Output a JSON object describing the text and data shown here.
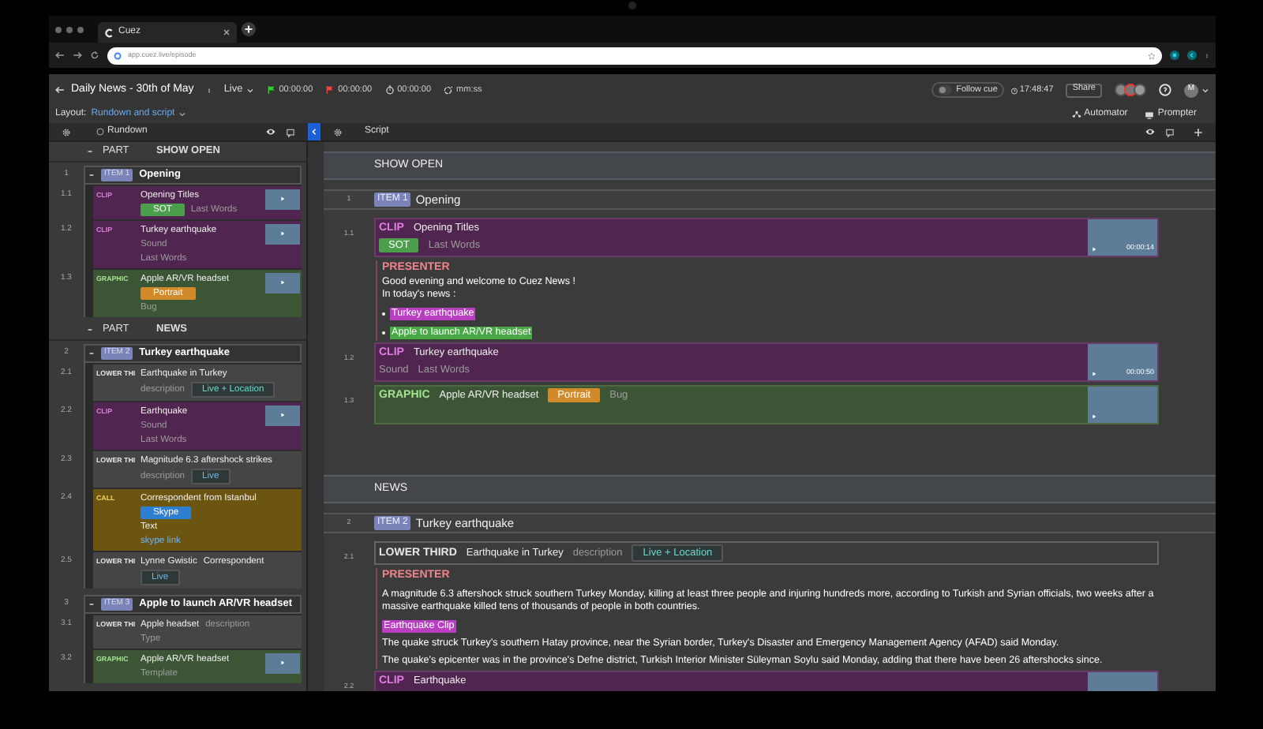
{
  "browser": {
    "tab_title": "Cuez",
    "url": "app.cuez.live/episode"
  },
  "header": {
    "title": "Daily News - 30th of May",
    "mode": "Live",
    "timers": [
      {
        "kind": "start",
        "text": "00:00:00"
      },
      {
        "kind": "end",
        "text": "00:00:00"
      },
      {
        "kind": "elapsed",
        "text": "00:00:00"
      },
      {
        "kind": "format",
        "text": "mm:ss"
      }
    ],
    "follow_cue": {
      "label": "Follow cue",
      "on": false
    },
    "clock": "17:48:47",
    "share": "Share",
    "user_initial": "M"
  },
  "layout": {
    "label": "Layout:",
    "value": "Rundown and script"
  },
  "tools": [
    "Automator",
    "Prompter"
  ],
  "panels": {
    "rundown": "Rundown",
    "script": "Script"
  },
  "rundown": [
    {
      "kind": "part",
      "label": "PART",
      "title": "SHOW OPEN"
    },
    {
      "kind": "item",
      "number": "1",
      "tag": "ITEM 1",
      "title": "Opening",
      "elements": [
        {
          "number": "1.1",
          "kind": "clip",
          "label": "CLIP",
          "thumbnail": true,
          "lines": [
            [
              {
                "kind": "title",
                "text": "Opening Titles"
              }
            ],
            [
              {
                "kind": "badge",
                "text": "SOT",
                "color": "#4b9e4b"
              },
              {
                "kind": "muted",
                "text": "Last Words"
              }
            ]
          ]
        },
        {
          "number": "1.2",
          "kind": "clip",
          "label": "CLIP",
          "thumbnail": true,
          "lines": [
            [
              {
                "kind": "title",
                "text": "Turkey earthquake"
              }
            ],
            [
              {
                "kind": "muted",
                "text": "Sound"
              }
            ],
            [
              {
                "kind": "muted",
                "text": "Last Words"
              }
            ]
          ]
        },
        {
          "number": "1.3",
          "kind": "graphic",
          "label": "GRAPHIC",
          "thumbnail": true,
          "lines": [
            [
              {
                "kind": "title",
                "text": "Apple AR/VR headset"
              }
            ],
            [
              {
                "kind": "badge",
                "text": "Portrait",
                "color": "#d08a2a"
              }
            ],
            [
              {
                "kind": "muted",
                "text": "Bug"
              }
            ]
          ]
        }
      ]
    },
    {
      "kind": "part",
      "label": "PART",
      "title": "NEWS"
    },
    {
      "kind": "item",
      "number": "2",
      "tag": "ITEM 2",
      "title": "Turkey earthquake",
      "elements": [
        {
          "number": "2.1",
          "kind": "lower_third",
          "label": "LOWER THI",
          "thumbnail": false,
          "lines": [
            [
              {
                "kind": "title",
                "text": "Earthquake in Turkey"
              }
            ],
            [
              {
                "kind": "muted",
                "text": "description"
              },
              {
                "kind": "tag",
                "text": "Live + Location",
                "color": "#6fd6c8"
              }
            ]
          ]
        },
        {
          "number": "2.2",
          "kind": "clip",
          "label": "CLIP",
          "thumbnail": true,
          "lines": [
            [
              {
                "kind": "title",
                "text": "Earthquake"
              }
            ],
            [
              {
                "kind": "muted",
                "text": "Sound"
              }
            ],
            [
              {
                "kind": "muted",
                "text": "Last Words"
              }
            ]
          ]
        },
        {
          "number": "2.3",
          "kind": "lower_third",
          "label": "LOWER THI",
          "thumbnail": false,
          "lines": [
            [
              {
                "kind": "title",
                "text": "Magnitude 6.3 aftershock strikes"
              }
            ],
            [
              {
                "kind": "muted",
                "text": "description"
              },
              {
                "kind": "tag",
                "text": "Live",
                "color": "#6fb6e8"
              }
            ]
          ]
        },
        {
          "number": "2.4",
          "kind": "call",
          "label": "CALL",
          "thumbnail": false,
          "lines": [
            [
              {
                "kind": "title",
                "text": "Correspondent from Istanbul"
              }
            ],
            [
              {
                "kind": "badge",
                "text": "Skype",
                "color": "#2f7fd0"
              }
            ],
            [
              {
                "kind": "title",
                "text": "Text"
              }
            ],
            [
              {
                "kind": "link",
                "text": "skype link"
              }
            ]
          ]
        },
        {
          "number": "2.5",
          "kind": "lower_third",
          "label": "LOWER THI",
          "thumbnail": false,
          "lines": [
            [
              {
                "kind": "title",
                "text": "Lynne Gwistic"
              },
              {
                "kind": "title",
                "text": "Correspondent"
              }
            ],
            [
              {
                "kind": "tag",
                "text": "Live",
                "color": "#6fb6e8"
              }
            ]
          ]
        }
      ]
    },
    {
      "kind": "item",
      "number": "3",
      "tag": "ITEM 3",
      "title": "Apple to launch AR/VR headset",
      "elements": [
        {
          "number": "3.1",
          "kind": "lower_third",
          "label": "LOWER THI",
          "thumbnail": false,
          "lines": [
            [
              {
                "kind": "title",
                "text": "Apple headset"
              },
              {
                "kind": "muted",
                "text": "description"
              }
            ],
            [
              {
                "kind": "muted",
                "text": "Type"
              }
            ]
          ]
        },
        {
          "number": "3.2",
          "kind": "graphic",
          "label": "GRAPHIC",
          "thumbnail": true,
          "lines": [
            [
              {
                "kind": "title",
                "text": "Apple AR/VR headset"
              }
            ],
            [
              {
                "kind": "muted",
                "text": "Template"
              }
            ]
          ]
        }
      ]
    }
  ],
  "script": [
    {
      "kind": "part",
      "title": "SHOW OPEN"
    },
    {
      "kind": "item",
      "number": "1",
      "tag": "ITEM 1",
      "title": "Opening"
    },
    {
      "kind": "clip",
      "number": "1.1",
      "label": "CLIP",
      "thumbnail": true,
      "duration": "00:00:14",
      "lines": [
        [
          {
            "kind": "title",
            "text": "Opening Titles"
          }
        ],
        [
          {
            "kind": "badge",
            "text": "SOT",
            "color": "#4b9e4b"
          },
          {
            "kind": "muted",
            "text": "Last Words"
          }
        ]
      ]
    },
    {
      "kind": "presenter",
      "label": "PRESENTER",
      "paragraphs": [
        {
          "kind": "line",
          "text": "Good evening and welcome to Cuez News !"
        },
        {
          "kind": "line",
          "text": "In today's news :"
        },
        {
          "kind": "bullet",
          "text": "Turkey earthquake",
          "color": "#b83fc0"
        },
        {
          "kind": "bullet",
          "text": "Apple to launch AR/VR headset",
          "color": "#48a846"
        }
      ]
    },
    {
      "kind": "clip",
      "number": "1.2",
      "label": "CLIP",
      "thumbnail": true,
      "duration": "00:00:50",
      "lines": [
        [
          {
            "kind": "title",
            "text": "Turkey earthquake"
          }
        ],
        [
          {
            "kind": "muted",
            "text": "Sound"
          },
          {
            "kind": "muted",
            "text": "Last Words"
          }
        ]
      ]
    },
    {
      "kind": "graphic",
      "number": "1.3",
      "label": "GRAPHIC",
      "thumbnail": true,
      "lines": [
        [
          {
            "kind": "title",
            "text": "Apple AR/VR headset"
          },
          {
            "kind": "badge",
            "text": "Portrait",
            "color": "#d08a2a"
          },
          {
            "kind": "muted",
            "text": "Bug"
          }
        ]
      ]
    },
    {
      "kind": "part",
      "title": "NEWS"
    },
    {
      "kind": "item",
      "number": "2",
      "tag": "ITEM 2",
      "title": "Turkey earthquake"
    },
    {
      "kind": "lower_third",
      "number": "2.1",
      "label": "LOWER THIRD",
      "thumbnail": false,
      "lines": [
        [
          {
            "kind": "title",
            "text": "Earthquake in Turkey"
          },
          {
            "kind": "muted",
            "text": "description"
          },
          {
            "kind": "tag",
            "text": "Live + Location",
            "color": "#6fd6c8"
          }
        ]
      ]
    },
    {
      "kind": "presenter",
      "label": "PRESENTER",
      "paragraphs": [
        {
          "kind": "paragraph",
          "text": "A magnitude 6.3 aftershock struck southern Turkey Monday, killing at least three people and injuring hundreds more, according to Turkish and Syrian officials, two weeks after a massive earthquake killed tens of thousands of people in both countries."
        },
        {
          "kind": "highlight",
          "text": "Earthquake Clip",
          "color": "#b83fc0"
        },
        {
          "kind": "paragraph",
          "text": "The quake struck Turkey's southern Hatay province, near the Syrian border, Turkey's Disaster and Emergency Management Agency (AFAD) said Monday."
        },
        {
          "kind": "paragraph",
          "text": "The quake's epicenter was in the province's Defne district, Turkish Interior Minister Süleyman Soylu said Monday, adding that there have been 26 aftershocks since."
        }
      ]
    },
    {
      "kind": "clip",
      "number": "2.2",
      "label": "CLIP",
      "thumbnail": true,
      "lines": [
        [
          {
            "kind": "title",
            "text": "Earthquake"
          }
        ]
      ]
    }
  ]
}
